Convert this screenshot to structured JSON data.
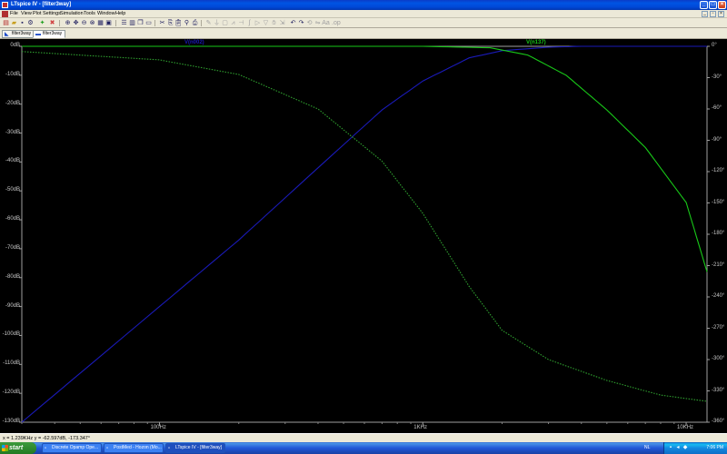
{
  "window": {
    "title": "LTspice IV - [filter3way]"
  },
  "menu": [
    "File",
    "View",
    "Plot Settings",
    "Simulation",
    "Tools",
    "Window",
    "Help"
  ],
  "tabs": [
    {
      "label": "filter3way",
      "active": false
    },
    {
      "label": "filter3way",
      "active": true
    }
  ],
  "plot": {
    "traces": [
      {
        "label": "V(n002)",
        "color": "#1a1ab8"
      },
      {
        "label": "V(n137)",
        "color": "#18c818"
      }
    ],
    "left_axis": [
      "0dB",
      "-10dB",
      "-20dB",
      "-30dB",
      "-40dB",
      "-50dB",
      "-60dB",
      "-70dB",
      "-80dB",
      "-90dB",
      "-100dB",
      "-110dB",
      "-120dB",
      "-130dB"
    ],
    "right_axis": [
      "0°",
      "-30°",
      "-60°",
      "-90°",
      "-120°",
      "-150°",
      "-180°",
      "-210°",
      "-240°",
      "-270°",
      "-300°",
      "-330°",
      "-360°"
    ],
    "x_axis": [
      "100Hz",
      "1KHz",
      "10KHz"
    ]
  },
  "chart_data": {
    "type": "line",
    "x_scale": "log",
    "xlim": [
      30,
      12000
    ],
    "ylim_left": [
      -130,
      0
    ],
    "ylim_right": [
      -360,
      0
    ],
    "grid": false,
    "series": [
      {
        "name": "V(n002)",
        "color": "#1a1ab8",
        "axis": "left",
        "style": "solid",
        "x": [
          30,
          100,
          200,
          400,
          700,
          1000,
          1500,
          2000,
          3000,
          4000,
          6000,
          12000
        ],
        "y": [
          -130,
          -90,
          -67,
          -42,
          -22,
          -12,
          -4,
          -1.5,
          -0.3,
          0,
          0,
          0
        ]
      },
      {
        "name": "V(n137)",
        "color": "#18c818",
        "axis": "left",
        "style": "solid",
        "x": [
          30,
          300,
          1000,
          1800,
          2500,
          3500,
          5000,
          7000,
          10000,
          12000
        ],
        "y": [
          0,
          0,
          0,
          -0.5,
          -3,
          -10,
          -22,
          -35,
          -54,
          -78
        ]
      },
      {
        "name": "phase",
        "color": "#2fa02f",
        "axis": "right",
        "style": "dotted",
        "x": [
          30,
          100,
          200,
          400,
          700,
          1000,
          1500,
          2000,
          3000,
          5000,
          8000,
          12000
        ],
        "y": [
          -5,
          -13,
          -27,
          -60,
          -110,
          -160,
          -230,
          -272,
          -300,
          -320,
          -334,
          -340
        ]
      }
    ]
  },
  "status": {
    "text": "x = 1.239KHz   y = -62.597dB, -173.347°"
  },
  "taskbar": {
    "start_label": "start",
    "items": [
      {
        "label": "Discrete Opamp Ope...",
        "active": false
      },
      {
        "label": "PostMed - Hozon (Mo...",
        "active": false
      },
      {
        "label": "LTspice IV - [filter3way]",
        "active": true
      }
    ],
    "lang": "NL",
    "clock": "7:06 PM"
  }
}
